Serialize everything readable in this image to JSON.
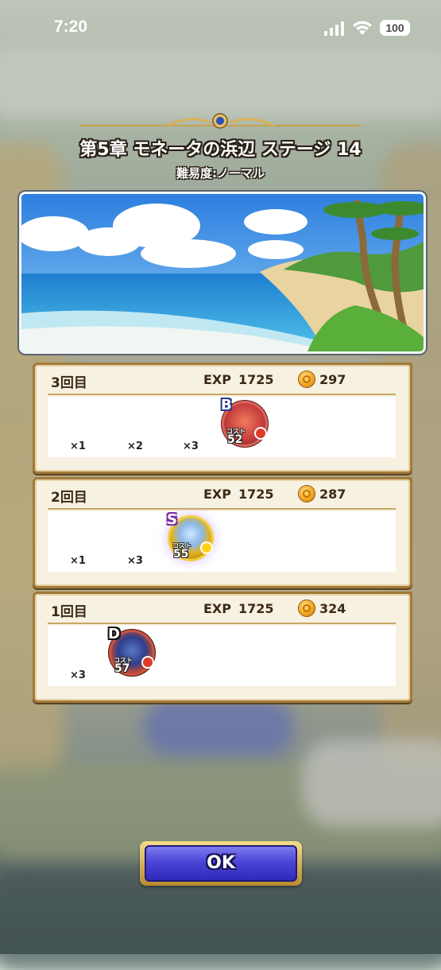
{
  "status_bar": {
    "time": "7:20",
    "battery": "100"
  },
  "header": {
    "title": "第5章 モネータの浜辺 ステージ 14",
    "difficulty": "難易度:ノーマル"
  },
  "results": [
    {
      "run": "3回目",
      "exp_label": "EXP",
      "exp": "1725",
      "gold": "297",
      "drops": [
        {
          "qty": "×1",
          "type": "item"
        },
        {
          "qty": "×2",
          "type": "item"
        },
        {
          "qty": "×3",
          "type": "item"
        },
        {
          "type": "monster",
          "rank": "B",
          "cost_label": "コスト",
          "cost": "52",
          "color": "#c94040",
          "dot": "#e23a2a"
        }
      ]
    },
    {
      "run": "2回目",
      "exp_label": "EXP",
      "exp": "1725",
      "gold": "287",
      "drops": [
        {
          "qty": "×1",
          "type": "item"
        },
        {
          "qty": "×3",
          "type": "item"
        },
        {
          "type": "monster",
          "rank": "S",
          "cost_label": "コスト",
          "cost": "55",
          "color": "#e2b21e",
          "dot": "#ffd21a"
        }
      ]
    },
    {
      "run": "1回目",
      "exp_label": "EXP",
      "exp": "1725",
      "gold": "324",
      "drops": [
        {
          "qty": "×3",
          "type": "item"
        },
        {
          "type": "monster",
          "rank": "D",
          "cost_label": "コスト",
          "cost": "57",
          "color": "#b8483a",
          "dot": "#e23a2a"
        }
      ]
    }
  ],
  "ok_button": {
    "label": "OK"
  }
}
